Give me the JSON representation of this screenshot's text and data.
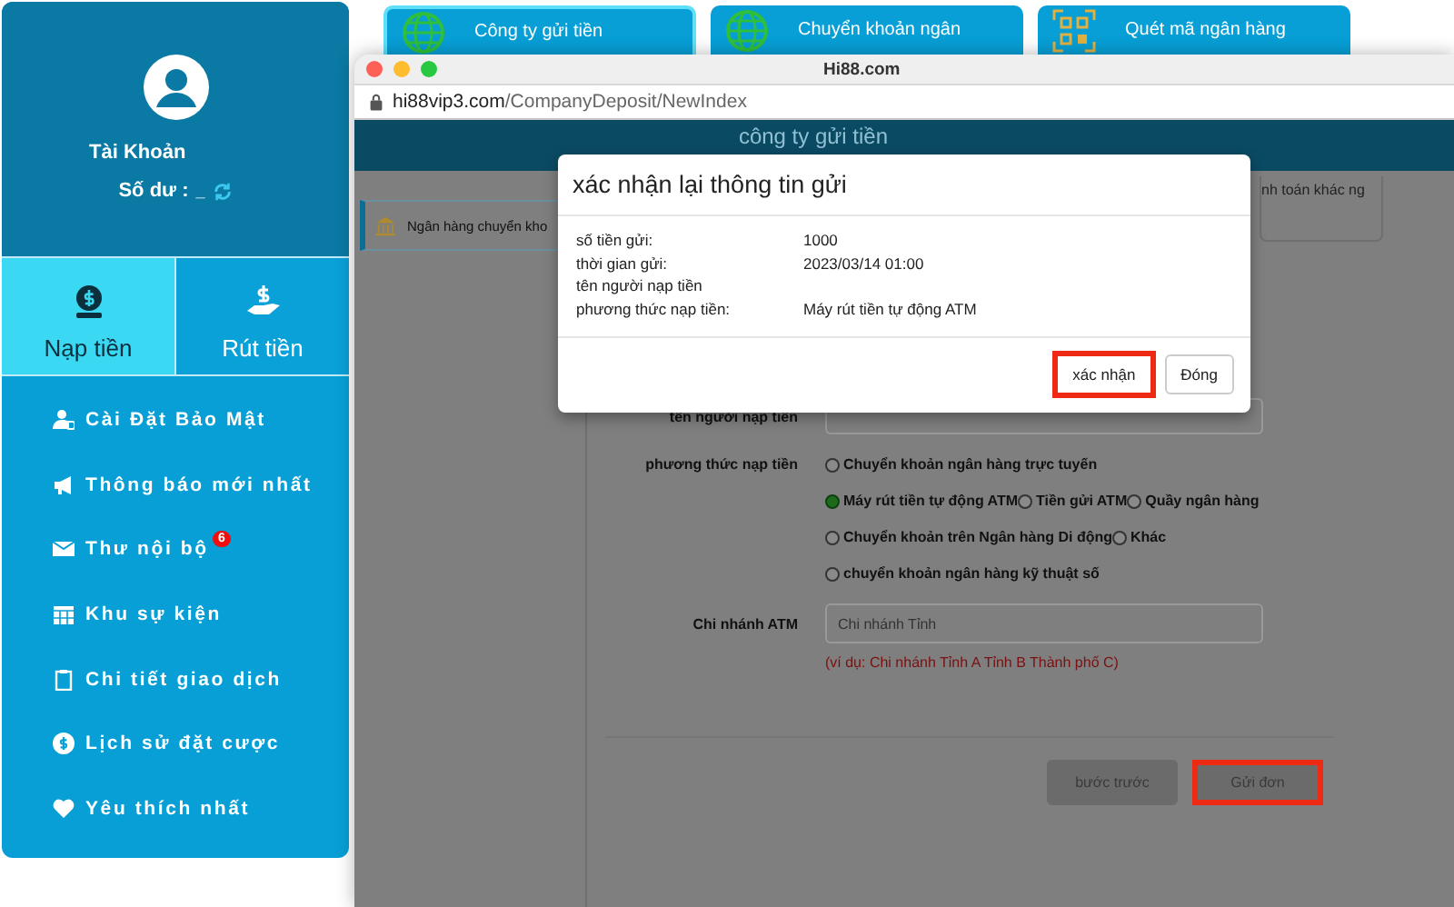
{
  "sidebar": {
    "account_label": "Tài Khoản",
    "balance_label": "Số dư :",
    "balance_value": "_",
    "tabs": [
      {
        "label": "Nạp tiền",
        "selected": true
      },
      {
        "label": "Rút tiền",
        "selected": false
      }
    ],
    "menu": [
      {
        "label": "Cài Đặt Bảo Mật"
      },
      {
        "label": "Thông báo mới nhất"
      },
      {
        "label": "Thư nội bộ",
        "badge": "6"
      },
      {
        "label": "Khu sự kiện"
      },
      {
        "label": "Chi tiết giao dịch"
      },
      {
        "label": "Lịch sử đặt cược"
      },
      {
        "label": "Yêu thích nhất"
      }
    ]
  },
  "method_cards": [
    {
      "label": "Công ty gửi tiền",
      "selected": true
    },
    {
      "label": "Chuyển khoản ngân",
      "selected": false
    },
    {
      "label": "Quét mã ngân hàng",
      "selected": false
    }
  ],
  "browser": {
    "title": "Hi88.com",
    "url_host": "hi88vip3.com",
    "url_path": "/CompanyDeposit/NewIndex"
  },
  "page": {
    "header": "công ty gửi tiền",
    "bank_tab": "Ngân hàng chuyển kho",
    "side_card_text": "nh toán khác ng",
    "form": {
      "name_label": "tên người nạp tiền",
      "method_label": "phương thức nạp tiền",
      "method_rows": [
        {
          "options": [
            {
              "label": "Chuyển khoản ngân hàng trực tuyến",
              "selected": false
            }
          ]
        },
        {
          "options": [
            {
              "label": "Máy rút tiền tự động ATM",
              "selected": true
            },
            {
              "label": "Tiền gửi ATM",
              "selected": false
            },
            {
              "label": "Quầy ngân hàng",
              "selected": false
            }
          ]
        },
        {
          "options": [
            {
              "label": "Chuyển khoản trên Ngân hàng Di động",
              "selected": false
            },
            {
              "label": "Khác",
              "selected": false
            }
          ]
        },
        {
          "options": [
            {
              "label": "chuyển khoản ngân hàng kỹ thuật số",
              "selected": false
            }
          ]
        }
      ],
      "branch_label": "Chi nhánh ATM",
      "branch_value": "Chi nhánh Tỉnh",
      "branch_hint": "(ví dụ: Chi nhánh Tỉnh A Tỉnh B Thành phố C)",
      "buttons": [
        {
          "label": "bước trước",
          "highlighted": false
        },
        {
          "label": "Gửi đơn",
          "highlighted": true
        }
      ]
    }
  },
  "modal": {
    "title": "xác nhận lại thông tin gửi",
    "rows": [
      {
        "label": "số tiền gửi:",
        "value": "1000"
      },
      {
        "label": "thời gian gửi:",
        "value": "2023/03/14 01:00"
      },
      {
        "label": "tên người nạp tiền"
      },
      {
        "label": "phương thức nạp tiền:",
        "value": "Máy rút tiền tự động ATM"
      }
    ],
    "buttons": [
      {
        "label": "xác nhận",
        "highlighted": true
      },
      {
        "label": "Đóng",
        "highlighted": false
      }
    ]
  }
}
